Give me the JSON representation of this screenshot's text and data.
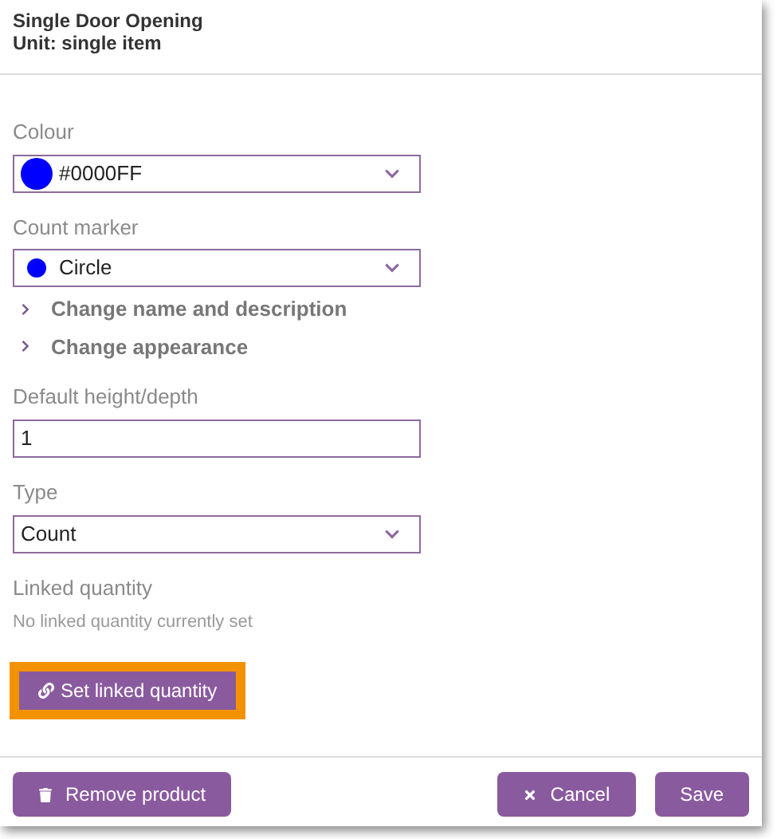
{
  "header": {
    "title": "Single Door Opening",
    "subtitle": "Unit: single item"
  },
  "fields": [
    {
      "kind": "select",
      "label": "Colour",
      "value": "#0000FF",
      "swatch": {
        "color": "#0000ff",
        "kind": "fill"
      }
    },
    {
      "kind": "select",
      "label": "Count marker",
      "value": "Circle",
      "swatch": {
        "color": "#0000ff",
        "kind": "marker"
      },
      "links": [
        "Change name and description",
        "Change appearance"
      ]
    },
    {
      "kind": "input",
      "label": "Default height/depth",
      "value": "1"
    },
    {
      "kind": "select",
      "label": "Type",
      "value": "Count"
    },
    {
      "kind": "linked",
      "label": "Linked quantity",
      "note": "No linked quantity currently set",
      "button": {
        "label": "Set linked quantity",
        "highlighted": true
      }
    }
  ],
  "footer": {
    "left": [
      {
        "label": "Remove product",
        "kind": "remove"
      }
    ],
    "right": [
      {
        "label": "Cancel",
        "kind": "cancel"
      },
      {
        "label": "Save",
        "kind": "save"
      }
    ]
  }
}
